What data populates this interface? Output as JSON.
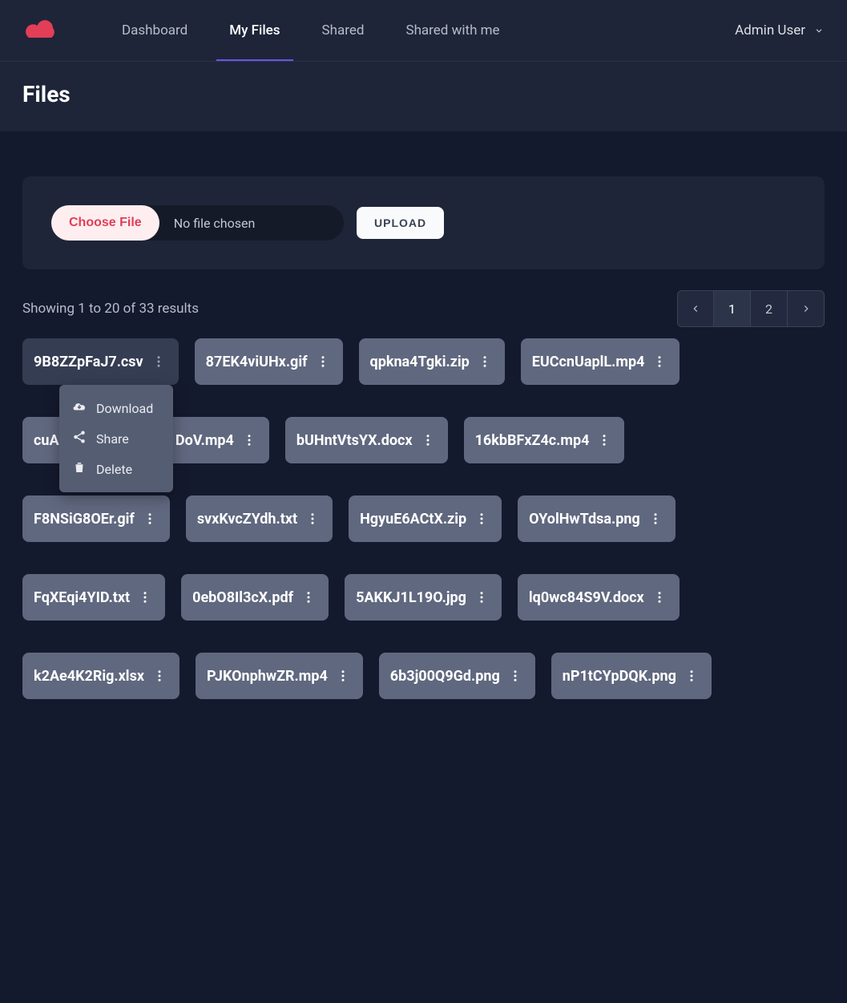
{
  "nav": {
    "tabs": [
      "Dashboard",
      "My Files",
      "Shared",
      "Shared with me"
    ],
    "active_index": 1,
    "user": "Admin User"
  },
  "page": {
    "title": "Files"
  },
  "upload": {
    "choose_label": "Choose File",
    "file_status": "No file chosen",
    "upload_label": "UPLOAD"
  },
  "results": {
    "text": "Showing 1 to 20 of 33 results"
  },
  "pagination": {
    "pages": [
      "1",
      "2"
    ],
    "current_index": 0
  },
  "files": {
    "active_index": 0,
    "rows": [
      [
        "9B8ZZpFaJ7.csv",
        "87EK4viUHx.gif",
        "qpkna4Tgki.zip",
        "EUCcnUaplL.mp4"
      ],
      [
        "cuA",
        "a0GrPr1DoV.mp4",
        "bUHntVtsYX.docx",
        "16kbBFxZ4c.mp4"
      ],
      [
        "F8NSiG8OEr.gif",
        "svxKvcZYdh.txt",
        "HgyuE6ACtX.zip",
        "OYolHwTdsa.png"
      ],
      [
        "FqXEqi4YID.txt",
        "0ebO8Il3cX.pdf",
        "5AKKJ1L19O.jpg",
        "lq0wc84S9V.docx"
      ],
      [
        "k2Ae4K2Rig.xlsx",
        "PJKOnphwZR.mp4",
        "6b3j00Q9Gd.png",
        "nP1tCYpDQK.png"
      ]
    ]
  },
  "context_menu": {
    "items": [
      {
        "label": "Download",
        "icon": "download"
      },
      {
        "label": "Share",
        "icon": "share"
      },
      {
        "label": "Delete",
        "icon": "delete"
      }
    ]
  }
}
